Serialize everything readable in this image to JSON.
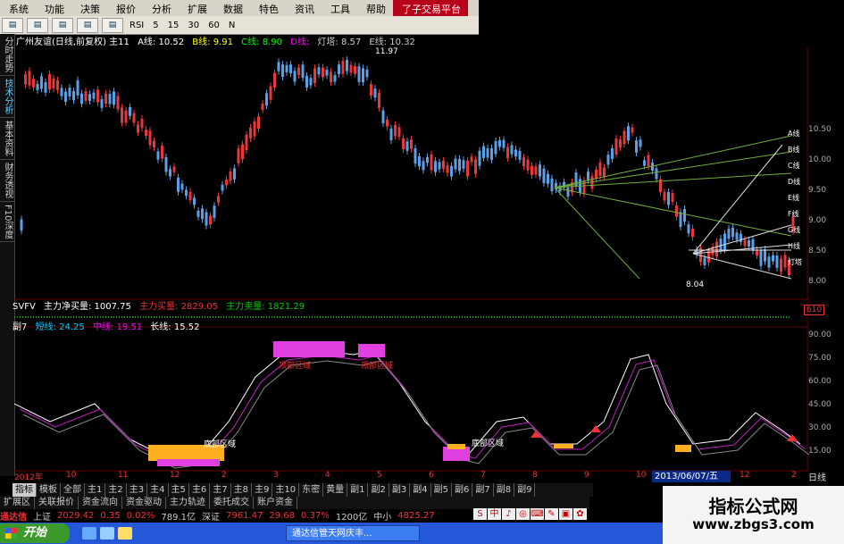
{
  "menu": [
    "系统",
    "功能",
    "决策",
    "报价",
    "分析",
    "扩展",
    "数据",
    "特色",
    "资讯",
    "工具",
    "帮助",
    "了子交易平台"
  ],
  "toolbar": [
    "RSI",
    "5",
    "15",
    "30",
    "60",
    "N"
  ],
  "side_tabs": [
    {
      "label": "分时走势",
      "active": false
    },
    {
      "label": "技术分析",
      "active": true
    },
    {
      "label": "基本资料",
      "active": false
    },
    {
      "label": "财务透视",
      "active": false
    },
    {
      "label": "F10深度",
      "active": false
    }
  ],
  "header": {
    "stock": "广州友谊(日线,前复权) 主11",
    "a": "A线: 10.52",
    "b": "B线: 9.91",
    "c": "C线: 8.90",
    "d": "D线: ",
    "tower": "灯塔: 8.57",
    "e": "E线: 10.32"
  },
  "price_high": "11.97",
  "price_low": "8.04",
  "right_price_scale": [
    "10.50",
    "10.00",
    "9.50",
    "9.00",
    "8.50",
    "8.00"
  ],
  "line_labels": [
    "A线",
    "B线",
    "C线",
    "D线",
    "E线",
    "F线",
    "G线",
    "H线",
    "灯塔"
  ],
  "svfv": {
    "name": "SVFV",
    "net": "主力净买量: 1007.75",
    "buy": "主力买量: 2829.05",
    "sell": "主力卖量: 1821.29"
  },
  "svfv_badge": "610",
  "sub": {
    "name": "副7",
    "short": "短线: 24.25",
    "mid": "中线: 19.51",
    "long": "长线: 15.52"
  },
  "sub_scale": [
    "90.00",
    "75.00",
    "60.00",
    "45.00",
    "30.00",
    "15.00"
  ],
  "zone_labels": {
    "top": "顶部区域",
    "bottom": "底部区域"
  },
  "x_axis": [
    "2012年",
    "10",
    "11",
    "12",
    "2",
    "3",
    "4",
    "5",
    "6",
    "7",
    "8",
    "9",
    "10",
    "11",
    "12",
    "2"
  ],
  "date_badge": "2013/06/07/五",
  "day_btn": "日线",
  "bottom_tabs": [
    "指标",
    "模板",
    "全部",
    "主1",
    "主2",
    "主3",
    "主4",
    "主5",
    "主6",
    "主7",
    "主8",
    "主9",
    "主10",
    "东密",
    "黄量",
    "副1",
    "副2",
    "副3",
    "副4",
    "副5",
    "副6",
    "副7",
    "副8",
    "副9"
  ],
  "bottom_tabs2": [
    "扩展区",
    "关联报价",
    "资金流向",
    "资金驱动",
    "主力轨迹",
    "委托成交",
    "账户资金"
  ],
  "status": {
    "brand": "通达信",
    "sh_label": "上证",
    "sh_val": "2029.42",
    "sh_chg": "0.35",
    "sh_pct": "0.02%",
    "sh_amt": "789.1亿",
    "sz_label": "深证",
    "sz_val": "7961.47",
    "sz_chg": "29.68",
    "sz_pct": "0.37%",
    "sz_amt": "1200亿",
    "zx_label": "中小",
    "zx_val": "4825.27"
  },
  "ime": [
    "S",
    "中",
    "♪",
    "◎",
    "⌨",
    "✎",
    "▣",
    "✿"
  ],
  "taskbar": {
    "start": "开始",
    "item": "通达信管天网庆丰..."
  },
  "watermark": {
    "title": "指标公式网",
    "url": "www.zbgs3.com"
  },
  "colors": {
    "up": "#e8383a",
    "down": "#5aa0e6",
    "mauve": "#c020c0",
    "orange": "#ffb020",
    "green": "#6fae3a"
  }
}
